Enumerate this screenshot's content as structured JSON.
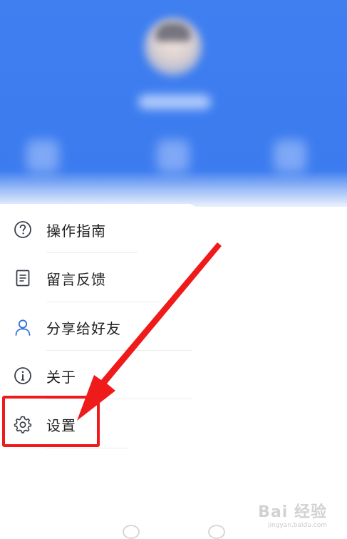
{
  "menu": {
    "items": [
      {
        "label": "操作指南",
        "icon": "help-circle-icon"
      },
      {
        "label": "留言反馈",
        "icon": "document-icon"
      },
      {
        "label": "分享给好友",
        "icon": "user-icon"
      },
      {
        "label": "关于",
        "icon": "info-icon"
      },
      {
        "label": "设置",
        "icon": "gear-icon"
      }
    ]
  },
  "annotation": {
    "highlight_color": "#ef1b1b"
  },
  "watermark": {
    "brand": "Bai 经验",
    "url": "jingyan.baidu.com"
  },
  "colors": {
    "header_blue": "#3f7ff0",
    "icon_color": "#3a3f4a",
    "text_color": "#222222"
  }
}
